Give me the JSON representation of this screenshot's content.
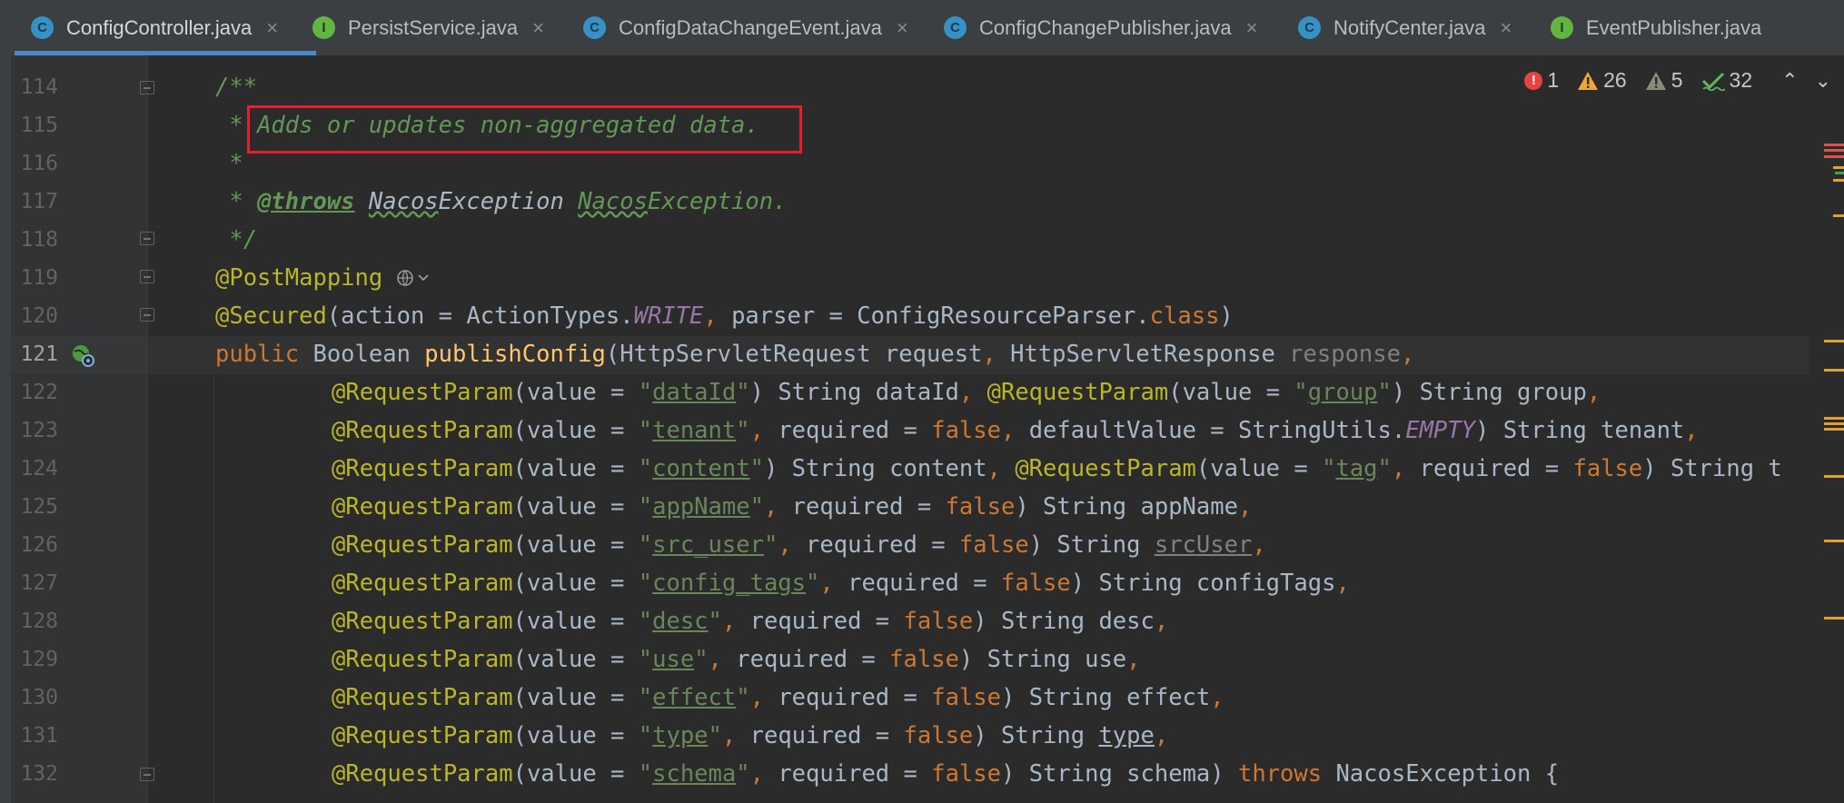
{
  "tabs": [
    {
      "label": "ConfigController.java",
      "icon": "class-icon",
      "letter": "C",
      "close": "×"
    },
    {
      "label": "PersistService.java",
      "icon": "interface-icon",
      "letter": "I",
      "close": "×"
    },
    {
      "label": "ConfigDataChangeEvent.java",
      "icon": "class-icon",
      "letter": "C",
      "close": "×"
    },
    {
      "label": "ConfigChangePublisher.java",
      "icon": "class-icon",
      "letter": "C",
      "close": "×"
    },
    {
      "label": "NotifyCenter.java",
      "icon": "class-icon",
      "letter": "C",
      "close": "×"
    },
    {
      "label": "EventPublisher.java",
      "icon": "interface-icon",
      "letter": "I",
      "close": ""
    }
  ],
  "inspections": {
    "errors": "1",
    "warnings": "26",
    "weak_warnings": "5",
    "typos": "32",
    "prev": "⌃",
    "next": "⌄"
  },
  "lines": {
    "n114": "114",
    "n115": "115",
    "n116": "116",
    "n117": "117",
    "n118": "118",
    "n119": "119",
    "n120": "120",
    "n121": "121",
    "n122": "122",
    "n123": "123",
    "n124": "124",
    "n125": "125",
    "n126": "126",
    "n127": "127",
    "n128": "128",
    "n129": "129",
    "n130": "130",
    "n131": "131",
    "n132": "132"
  },
  "code": {
    "l114": "/**",
    "l115_star": " * ",
    "l115_text": "Adds or updates non-aggregated data.",
    "l116": " *",
    "l117_star": " * ",
    "l117_tag": "@throws",
    "l117_a": "Nacos",
    "l117_b": "Exception ",
    "l117_c": "Nacos",
    "l117_d": "Exception.",
    "l118": " */",
    "l119": "@PostMapping",
    "l120_ann": "@Secured",
    "l120_a": "(action = ActionTypes.",
    "l120_write": "WRITE",
    "l120_comma": ", ",
    "l120_b": "parser = ConfigResourceParser.",
    "l120_class": "class",
    "l120_c": ")",
    "l121_pub": "public ",
    "l121_type": "Boolean ",
    "l121_fn": "publishConfig",
    "l121_a": "(HttpServletRequest request",
    "l121_comma": ", ",
    "l121_b": "HttpServletResponse ",
    "l121_resp": "response",
    "l121_end": ",",
    "rp": "@RequestParam",
    "val": "(value = ",
    "q": "\"",
    "req": "required = ",
    "false": "false",
    "comma": ",",
    "l122_k1": "dataId",
    "l122_a": ") String dataId",
    "l122_k2": "group",
    "l122_b": ") String group",
    "l123_k": "tenant",
    "l123_a": " defaultValue = StringUtils.",
    "l123_empty": "EMPTY",
    "l123_b": ") String tenant",
    "l124_k1": "content",
    "l124_a": ") String content",
    "l124_k2": "tag",
    "l124_b": ") String t",
    "l125_k": "appName",
    "l125_a": ") String appName",
    "l126_k": "src_user",
    "l126_a": ") String ",
    "l126_v": "srcUser",
    "l127_k": "config_tags",
    "l127_a": ") String configTags",
    "l128_k": "desc",
    "l128_a": ") String desc",
    "l129_k": "use",
    "l129_a": ") String use",
    "l130_k": "effect",
    "l130_a": ") String effect",
    "l131_k": "type",
    "l131_a": ") String ",
    "l131_v": "type",
    "l132_k": "schema",
    "l132_a": ") String schema) ",
    "l132_throws": "throws ",
    "l132_b": "NacosException {"
  },
  "colors": {
    "keyword": "#cc7832",
    "annotation": "#bbb529",
    "string": "#6a8759",
    "doc": "#629755",
    "highlight": "#e3202f",
    "accent": "#4a88c7"
  }
}
